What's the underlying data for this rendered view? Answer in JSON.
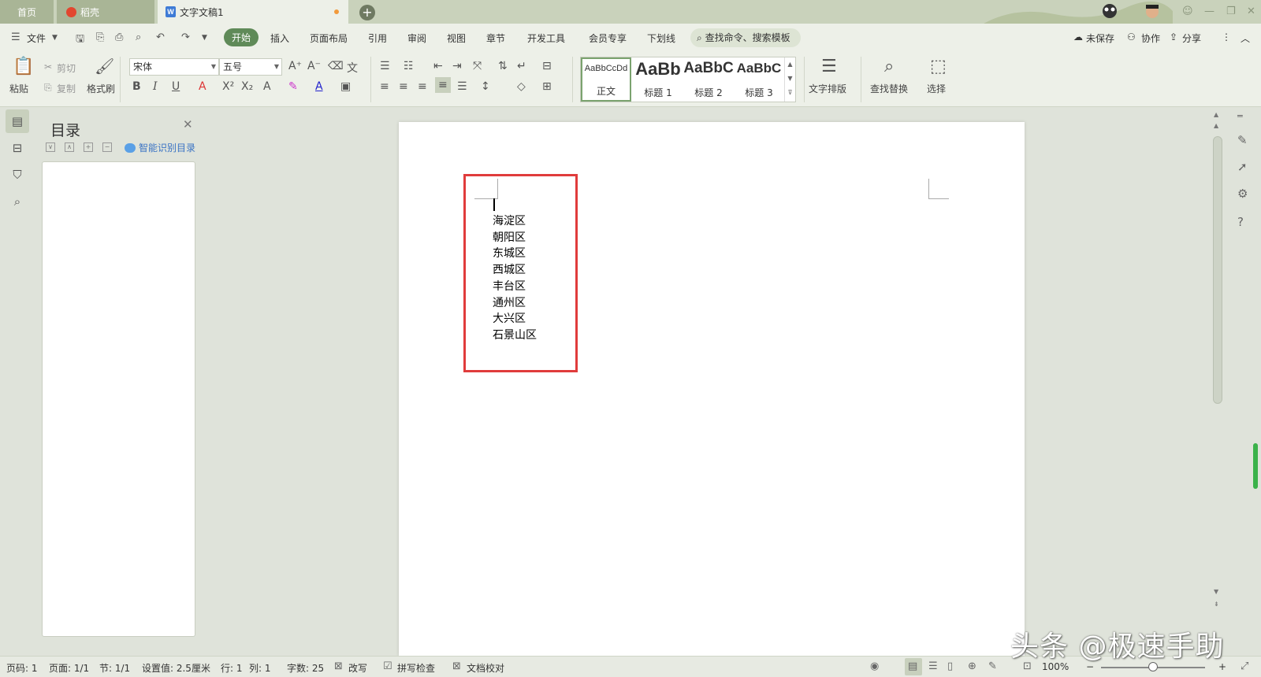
{
  "tabs": {
    "home": "首页",
    "daoke": "稻壳",
    "doc": "文字文稿1"
  },
  "menu": {
    "file": "文件",
    "items": [
      "开始",
      "插入",
      "页面布局",
      "引用",
      "审阅",
      "视图",
      "章节",
      "开发工具",
      "会员专享",
      "下划线"
    ],
    "active_index": 0,
    "search": "查找命令、搜索模板",
    "unsaved": "未保存",
    "collab": "协作",
    "share": "分享"
  },
  "ribbon": {
    "paste": "粘贴",
    "cut": "剪切",
    "copy": "复制",
    "format_painter": "格式刷",
    "font_name": "宋体",
    "font_size": "五号",
    "styles": [
      {
        "preview": "AaBbCcDd",
        "name": "正文"
      },
      {
        "preview": "AaBb",
        "name": "标题 1"
      },
      {
        "preview": "AaBbC",
        "name": "标题 2"
      },
      {
        "preview": "AaBbC",
        "name": "标题 3"
      }
    ],
    "text_layout": "文字排版",
    "find_replace": "查找替换",
    "select": "选择"
  },
  "toc": {
    "title": "目录",
    "smart": "智能识别目录"
  },
  "document": {
    "lines": [
      "海淀区",
      "朝阳区",
      "东城区",
      "西城区",
      "丰台区",
      "通州区",
      "大兴区",
      "石景山区"
    ]
  },
  "status": {
    "page": "页码: 1",
    "pages": "页面: 1/1",
    "section": "节: 1/1",
    "setting": "设置值: 2.5厘米",
    "row": "行: 1",
    "col": "列: 1",
    "words": "字数: 25",
    "revise": "改写",
    "spell": "拼写检查",
    "proof": "文档校对",
    "zoom": "100%",
    "zoom_level": 0.5
  },
  "watermark": "头条 @极速手助",
  "colors": {
    "accent": "#5f8a58",
    "highlight_box": "#e03c3c"
  }
}
